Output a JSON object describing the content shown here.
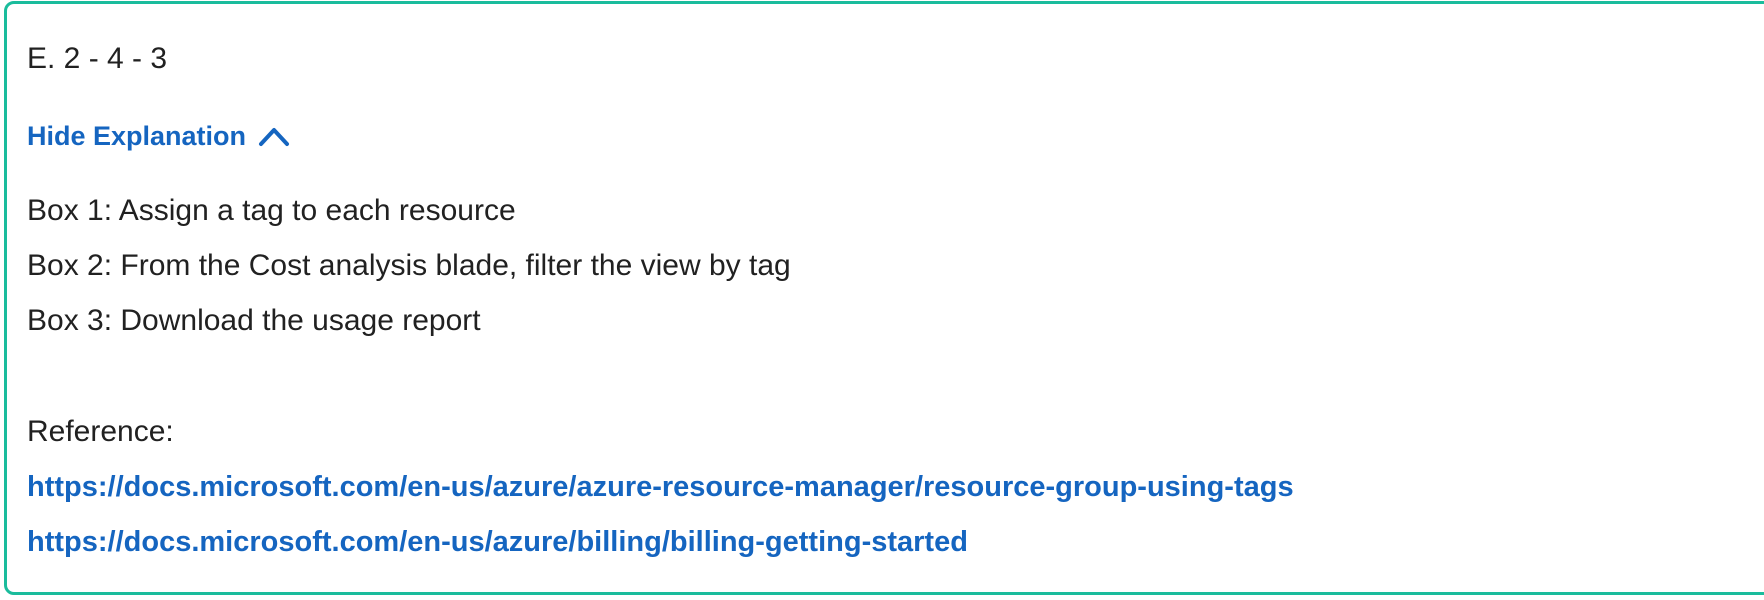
{
  "answer": {
    "text": "E. 2 - 4 - 3"
  },
  "toggle": {
    "label": "Hide Explanation",
    "icon": "chevron-up-icon"
  },
  "explanation": {
    "lines": [
      "Box 1: Assign a tag to each resource",
      "Box 2: From the Cost analysis blade, filter the view by tag",
      "Box 3: Download the usage report"
    ]
  },
  "reference": {
    "label": "Reference:",
    "links": [
      "https://docs.microsoft.com/en-us/azure/azure-resource-manager/resource-group-using-tags",
      "https://docs.microsoft.com/en-us/azure/billing/billing-getting-started"
    ]
  },
  "colors": {
    "border": "#1abc9c",
    "link": "#1565c0",
    "text": "#212121"
  }
}
